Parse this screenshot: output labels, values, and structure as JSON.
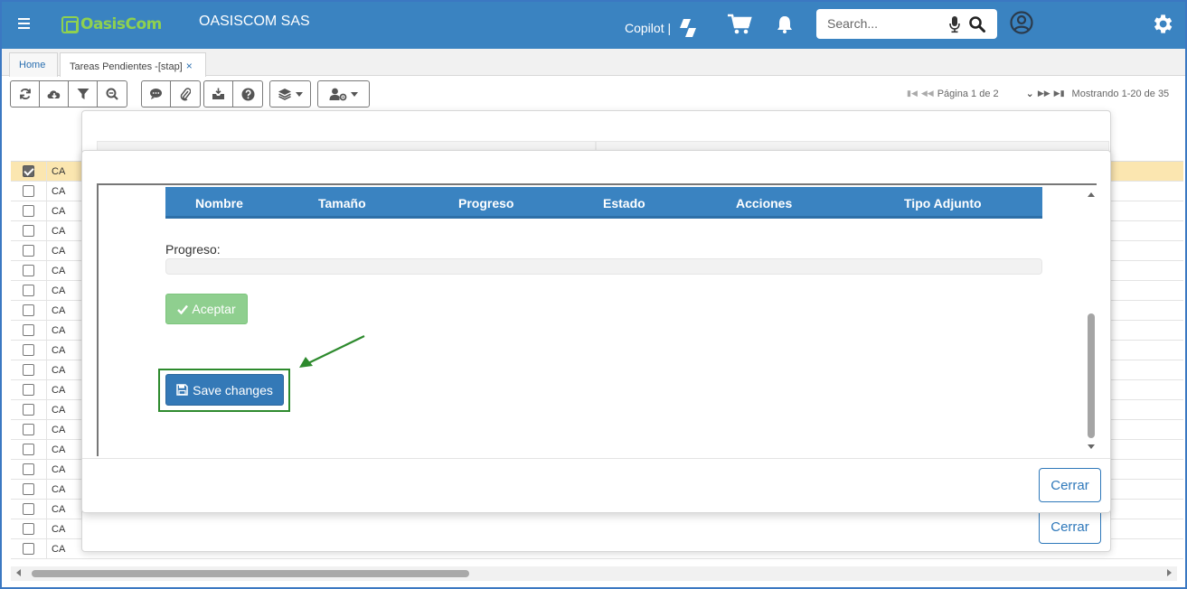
{
  "header": {
    "logo_text": "OasisCom",
    "company": "OASISCOM SAS",
    "copilot": "Copilot |",
    "search_placeholder": "Search..."
  },
  "tabs": {
    "home": "Home",
    "active": "Tareas Pendientes -[stap]",
    "close": "×"
  },
  "pager": {
    "page_text": "Página 1 de 2",
    "showing": "Mostrando 1-20 de 35"
  },
  "grid": {
    "row_code": "CA",
    "rows": [
      "CA",
      "CA",
      "CA",
      "CA",
      "CA",
      "CA",
      "CA",
      "CA",
      "CA",
      "CA",
      "CA",
      "CA",
      "CA",
      "CA",
      "CA",
      "CA",
      "CA",
      "CA",
      "CA",
      "CA"
    ]
  },
  "modal": {
    "columns": [
      "Nombre",
      "Tamaño",
      "Progreso",
      "Estado",
      "Acciones",
      "Tipo Adjunto"
    ],
    "progress_label": "Progreso:",
    "progress_value": 0,
    "accept_label": "Aceptar",
    "save_label": "Save changes",
    "close_label": "Cerrar"
  },
  "colors": {
    "header_bg": "#3a83c1",
    "logo_green": "#8fd14f",
    "accept_green": "#8fcf8f",
    "save_blue": "#3479b7",
    "annotation_green": "#2d8a2d",
    "selected_row": "#fbe6b0"
  }
}
